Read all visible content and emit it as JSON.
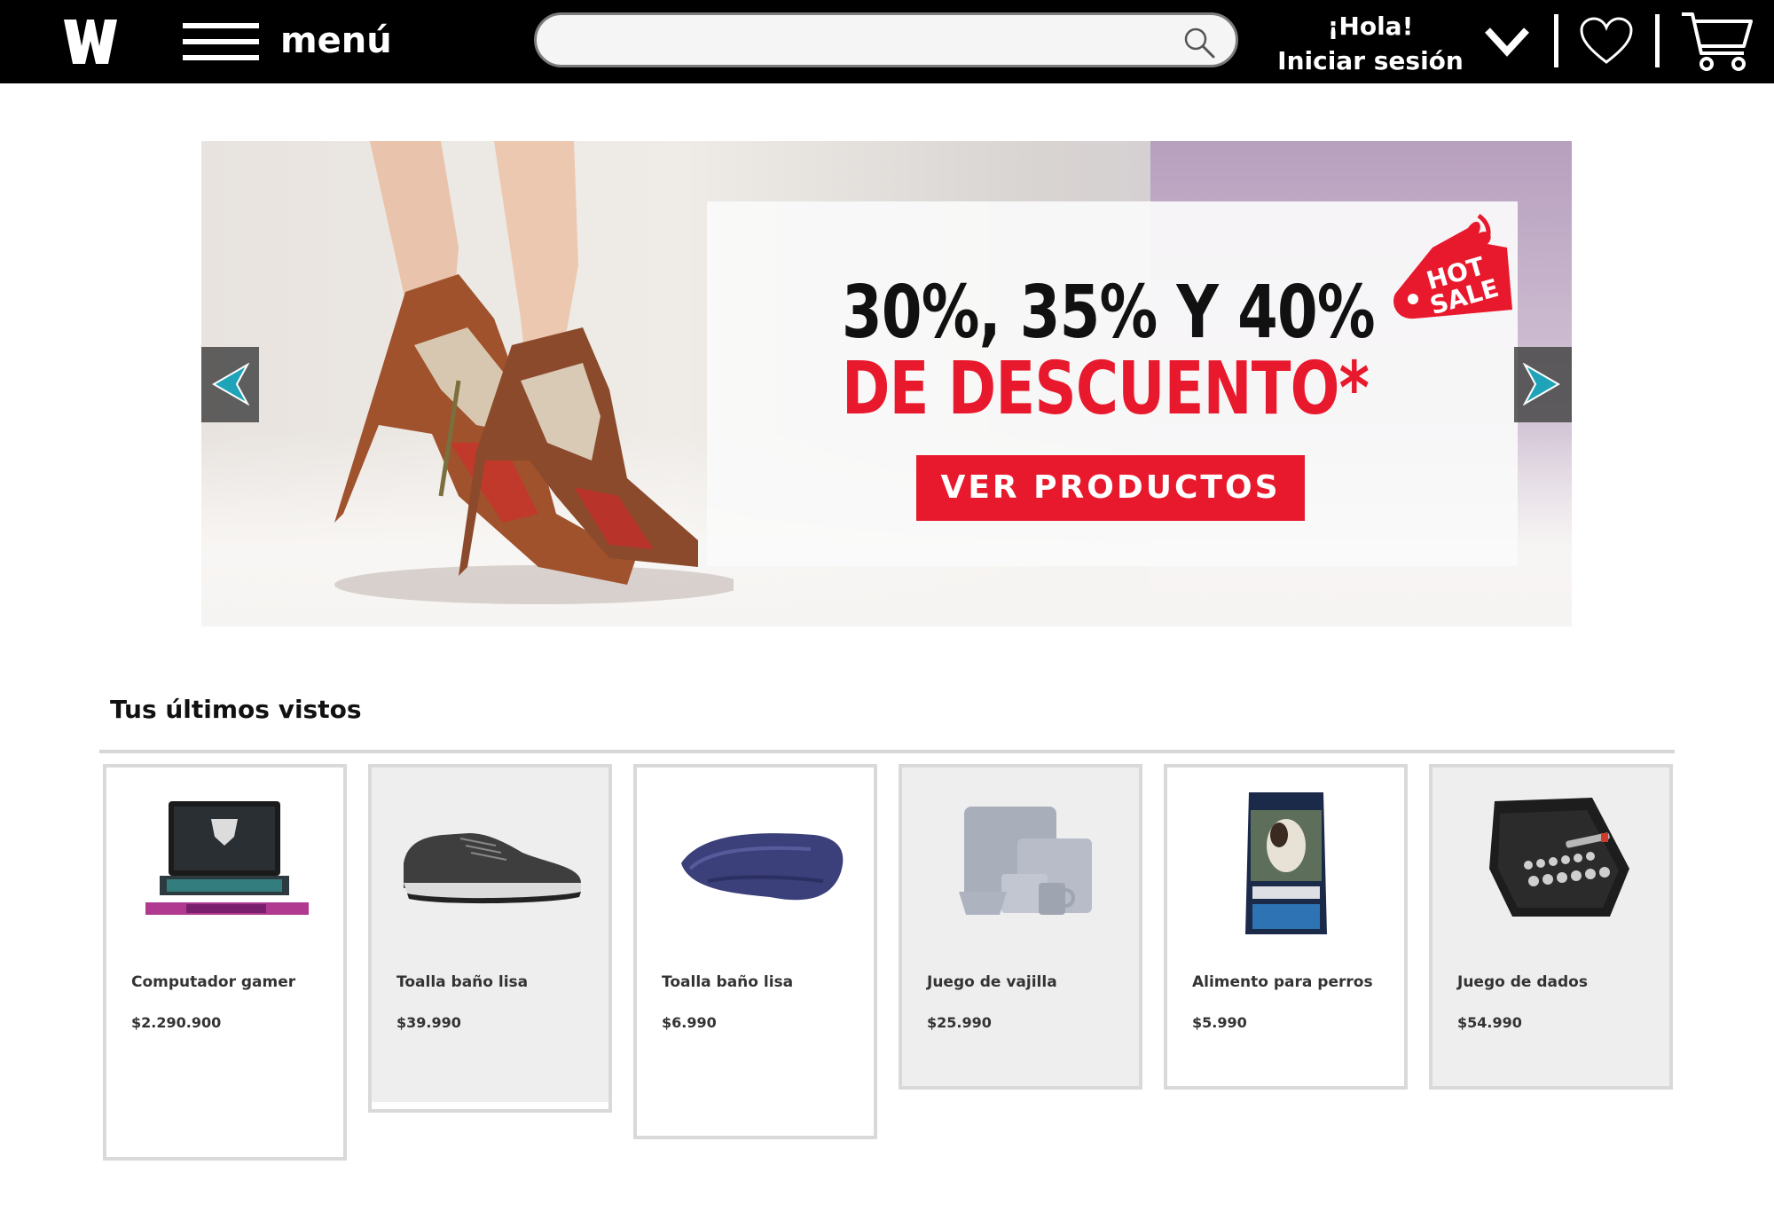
{
  "header": {
    "logo_alt": "W",
    "menu_label": "menú",
    "search_placeholder": "",
    "greeting_line1": "¡Hola!",
    "greeting_line2": "Iniciar sesión"
  },
  "banner": {
    "line1": "30%, 35% Y 40%",
    "line2": "DE DESCUENTO*",
    "cta_label": "VER PRODUCTOS",
    "tag_line1": "HOT",
    "tag_line2": "SALE",
    "colors": {
      "accent": "#e8192c",
      "arrow": "#1fa3b8"
    }
  },
  "recently_viewed": {
    "title": "Tus últimos vistos",
    "products": [
      {
        "name": "Computador gamer",
        "price": "$2.290.900",
        "icon": "laptop-icon"
      },
      {
        "name": "Toalla baño lisa",
        "price": "$39.990",
        "icon": "sneaker-icon"
      },
      {
        "name": "Toalla baño lisa",
        "price": "$6.990",
        "icon": "towel-icon"
      },
      {
        "name": "Juego de vajilla",
        "price": "$25.990",
        "icon": "dinnerware-icon"
      },
      {
        "name": "Alimento para perros",
        "price": "$5.990",
        "icon": "dog-food-bag-icon"
      },
      {
        "name": "Juego de dados",
        "price": "$54.990",
        "icon": "socket-set-icon"
      }
    ]
  }
}
